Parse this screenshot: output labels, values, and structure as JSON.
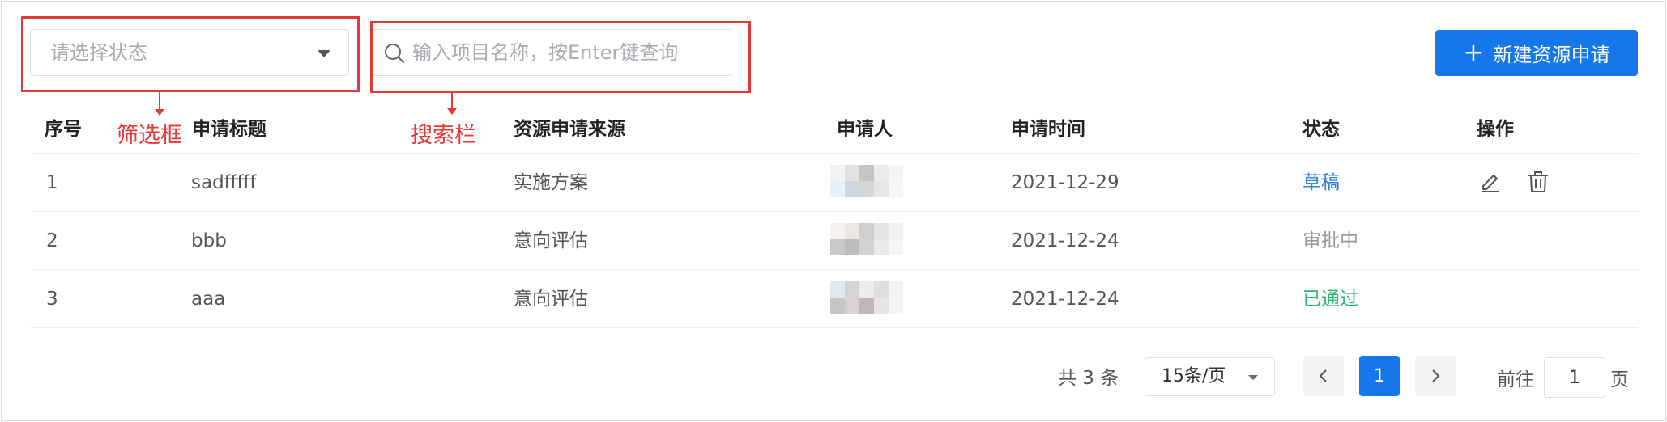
{
  "filter": {
    "placeholder": "请选择状态"
  },
  "search": {
    "placeholder": "输入项目名称，按Enter键查询"
  },
  "annotations": {
    "filter_label": "筛选框",
    "search_label": "搜索栏"
  },
  "toolbar": {
    "new_label": "新建资源申请",
    "new_icon": "plus-icon"
  },
  "table": {
    "headers": [
      "序号",
      "申请标题",
      "资源申请来源",
      "申请人",
      "申请时间",
      "状态",
      "操作"
    ],
    "rows": [
      {
        "index": "1",
        "title": "sadfffff",
        "source": "实施方案",
        "date": "2021-12-29",
        "status": "草稿",
        "status_color": "#2d7fd9",
        "has_actions": true
      },
      {
        "index": "2",
        "title": "bbb",
        "source": "意向评估",
        "date": "2021-12-24",
        "status": "审批中",
        "status_color": "#999999"
      },
      {
        "index": "3",
        "title": "aaa",
        "source": "意向评估",
        "date": "2021-12-24",
        "status": "已通过",
        "status_color": "#2bb673"
      }
    ],
    "row_icons": [
      "edit-icon",
      "delete-icon"
    ]
  },
  "pagination": {
    "total_text": "共 3 条",
    "page_size": "15条/页",
    "current_page": "1",
    "prev_icon": "chevron-left-icon",
    "next_icon": "chevron-right-icon",
    "goto_label": "前往",
    "goto_value": "1",
    "page_unit": "页"
  },
  "colors": {
    "primary": "#1677e8",
    "annotation": "#e53935"
  }
}
